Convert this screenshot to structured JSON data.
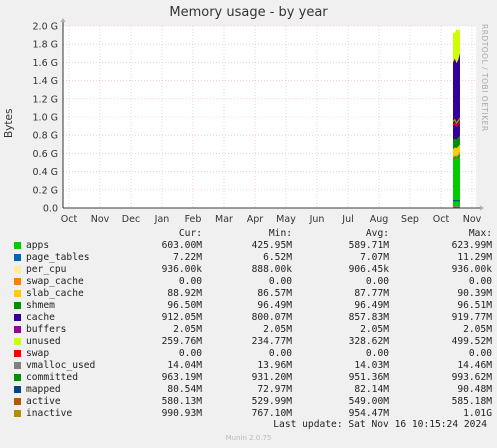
{
  "header": {
    "title": "Memory usage - by year",
    "watermark": "RRDTOOL / TOBI OETIKER"
  },
  "legend_header": {
    "cur": "Cur:",
    "min": "Min:",
    "avg": "Avg:",
    "max": "Max:"
  },
  "legend": [
    {
      "name": "apps",
      "color": "#00cc00",
      "cur": "603.00M",
      "min": "425.95M",
      "avg": "589.71M",
      "max": "623.99M"
    },
    {
      "name": "page_tables",
      "color": "#0066b3",
      "cur": "7.22M",
      "min": "6.52M",
      "avg": "7.07M",
      "max": "11.29M"
    },
    {
      "name": "per_cpu",
      "color": "#ffeb9c",
      "cur": "936.00k",
      "min": "888.00k",
      "avg": "906.45k",
      "max": "936.00k"
    },
    {
      "name": "swap_cache",
      "color": "#ff8000",
      "cur": "0.00",
      "min": "0.00",
      "avg": "0.00",
      "max": "0.00"
    },
    {
      "name": "slab_cache",
      "color": "#ffcc00",
      "cur": "88.92M",
      "min": "86.57M",
      "avg": "87.77M",
      "max": "90.39M"
    },
    {
      "name": "shmem",
      "color": "#008f00",
      "cur": "96.50M",
      "min": "96.49M",
      "avg": "96.49M",
      "max": "96.51M"
    },
    {
      "name": "cache",
      "color": "#330099",
      "cur": "912.05M",
      "min": "800.07M",
      "avg": "857.83M",
      "max": "919.77M"
    },
    {
      "name": "buffers",
      "color": "#990099",
      "cur": "2.05M",
      "min": "2.05M",
      "avg": "2.05M",
      "max": "2.05M"
    },
    {
      "name": "unused",
      "color": "#ccff00",
      "cur": "259.76M",
      "min": "234.77M",
      "avg": "328.62M",
      "max": "499.52M"
    },
    {
      "name": "swap",
      "color": "#ff0000",
      "cur": "0.00",
      "min": "0.00",
      "avg": "0.00",
      "max": "0.00"
    },
    {
      "name": "vmalloc_used",
      "color": "#808080",
      "cur": "14.04M",
      "min": "13.96M",
      "avg": "14.03M",
      "max": "14.46M"
    },
    {
      "name": "committed",
      "color": "#008f00",
      "cur": "963.19M",
      "min": "931.20M",
      "avg": "951.36M",
      "max": "993.62M"
    },
    {
      "name": "mapped",
      "color": "#00487d",
      "cur": "80.54M",
      "min": "72.97M",
      "avg": "82.14M",
      "max": "90.48M"
    },
    {
      "name": "active",
      "color": "#b35a00",
      "cur": "580.13M",
      "min": "529.99M",
      "avg": "549.00M",
      "max": "585.18M"
    },
    {
      "name": "inactive",
      "color": "#b38f00",
      "cur": "990.93M",
      "min": "767.10M",
      "avg": "954.47M",
      "max": "1.01G"
    }
  ],
  "footer": {
    "last_update": "Last update: Sat Nov 16 10:15:24 2024",
    "munin": "Munin 2.0.75"
  },
  "chart_data": {
    "type": "area",
    "title": "Memory usage - by year",
    "ylabel": "Bytes",
    "ylim": [
      0,
      2.0
    ],
    "y_unit": "G",
    "y_ticks": [
      "0.0",
      "0.2 G",
      "0.4 G",
      "0.6 G",
      "0.8 G",
      "1.0 G",
      "1.2 G",
      "1.4 G",
      "1.6 G",
      "1.8 G",
      "2.0 G"
    ],
    "x_ticks": [
      "Oct",
      "Nov",
      "Dec",
      "Jan",
      "Feb",
      "Mar",
      "Apr",
      "May",
      "Jun",
      "Jul",
      "Aug",
      "Sep",
      "Oct",
      "Nov"
    ],
    "data_present_from": "Oct",
    "stacked_series": [
      {
        "name": "apps",
        "color": "#00cc00",
        "values_G": [
          0.55,
          0.57,
          0.56,
          0.58,
          0.6
        ]
      },
      {
        "name": "page_tables",
        "color": "#0066b3",
        "values_G": [
          0.007,
          0.007,
          0.007,
          0.007,
          0.007
        ]
      },
      {
        "name": "per_cpu",
        "color": "#ffeb9c",
        "values_G": [
          0.001,
          0.001,
          0.001,
          0.001,
          0.001
        ]
      },
      {
        "name": "slab_cache",
        "color": "#ffcc00",
        "values_G": [
          0.088,
          0.088,
          0.088,
          0.088,
          0.089
        ]
      },
      {
        "name": "shmem",
        "color": "#008f00",
        "values_G": [
          0.096,
          0.096,
          0.096,
          0.096,
          0.096
        ]
      },
      {
        "name": "cache",
        "color": "#330099",
        "values_G": [
          0.86,
          0.88,
          0.84,
          0.86,
          0.91
        ]
      },
      {
        "name": "buffers",
        "color": "#990099",
        "values_G": [
          0.002,
          0.002,
          0.002,
          0.002,
          0.002
        ]
      },
      {
        "name": "unused",
        "color": "#ccff00",
        "values_G": [
          0.32,
          0.28,
          0.37,
          0.32,
          0.26
        ]
      }
    ],
    "line_series": [
      {
        "name": "committed",
        "color": "#008f00",
        "values_G": [
          0.95,
          0.96,
          0.94,
          0.95,
          0.96
        ]
      },
      {
        "name": "active",
        "color": "#b35a00",
        "values_G": [
          0.55,
          0.54,
          0.55,
          0.56,
          0.58
        ]
      },
      {
        "name": "inactive",
        "color": "#b38f00",
        "values_G": [
          0.95,
          0.97,
          0.93,
          0.96,
          0.99
        ]
      },
      {
        "name": "swap",
        "color": "#ff0000",
        "values_G": [
          0.91,
          0.93,
          0.9,
          0.92,
          0.94
        ]
      },
      {
        "name": "mapped",
        "color": "#00487d",
        "values_G": [
          0.08,
          0.08,
          0.08,
          0.08,
          0.08
        ]
      },
      {
        "name": "vmalloc_used",
        "color": "#808080",
        "values_G": [
          0.014,
          0.014,
          0.014,
          0.014,
          0.014
        ]
      }
    ]
  }
}
